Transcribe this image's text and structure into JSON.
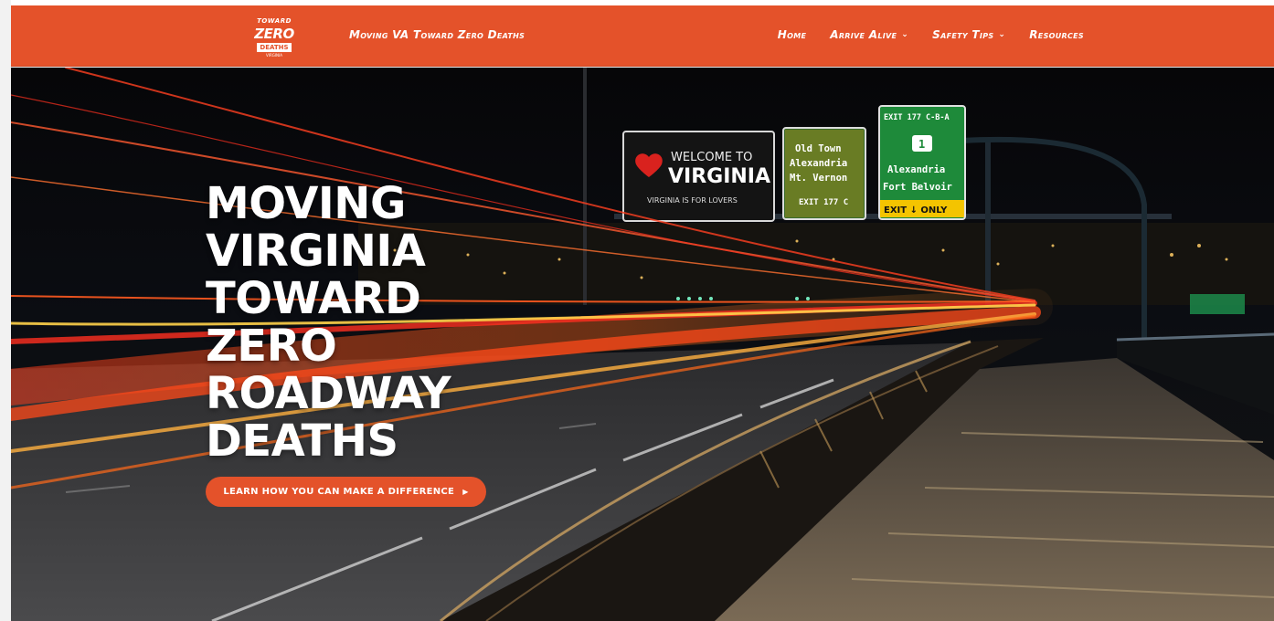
{
  "header": {
    "logo": {
      "line1": "TOWARD",
      "line2": "ZERO",
      "line3": "DEATHS",
      "line4": "VIRGINIA"
    },
    "site_title": "Moving VA Toward Zero Deaths",
    "nav": [
      {
        "label": "Home",
        "has_dropdown": false
      },
      {
        "label": "Arrive Alive",
        "has_dropdown": true
      },
      {
        "label": "Safety Tips",
        "has_dropdown": true
      },
      {
        "label": "Resources",
        "has_dropdown": false
      }
    ],
    "dropdown_icon": "chevron-down-icon",
    "accent_color": "#e4522a"
  },
  "hero": {
    "headline_lines": [
      "MOVING",
      "VIRGINIA",
      "TOWARD",
      "ZERO",
      "ROADWAY",
      "DEATHS"
    ],
    "cta_label": "LEARN HOW YOU CAN MAKE A DIFFERENCE",
    "cta_icon": "caret-right-icon",
    "signs": {
      "welcome": {
        "line1": "WELCOME TO",
        "line2": "VIRGINIA",
        "line3": "VIRGINIA IS FOR LOVERS"
      },
      "exit_c": {
        "line1": "Old Town",
        "line2": "Alexandria",
        "line3": "Mt. Vernon",
        "line4": "EXIT 177 C"
      },
      "exit_cba": {
        "top": "EXIT 177 C-B-A",
        "route": "1",
        "line1": "Alexandria",
        "line2": "Fort Belvoir",
        "bottom": "EXIT ↓ ONLY"
      }
    }
  }
}
